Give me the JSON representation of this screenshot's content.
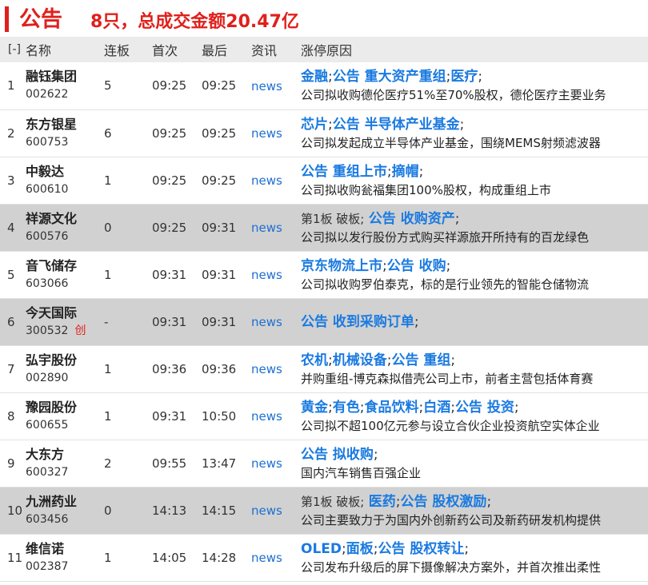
{
  "header": {
    "title": "公告",
    "summary": "8只，总成交金额20.47亿"
  },
  "columns": {
    "toggle": "[-]",
    "name": "名称",
    "boards": "连板",
    "first": "首次",
    "last": "最后",
    "news": "资讯",
    "reason": "涨停原因"
  },
  "rows": [
    {
      "idx": "1",
      "name": "融钰集团",
      "code": "002622",
      "badge": "",
      "boards": "5",
      "first": "09:25",
      "last": "09:25",
      "news": "news",
      "prefix": "",
      "tags": [
        "金融",
        "公告 重大资产重组",
        "医疗"
      ],
      "desc": "公司拟收购德伦医疗51%至70%股权，德伦医疗主要业务"
    },
    {
      "idx": "2",
      "name": "东方银星",
      "code": "600753",
      "badge": "",
      "boards": "6",
      "first": "09:25",
      "last": "09:25",
      "news": "news",
      "prefix": "",
      "tags": [
        "芯片",
        "公告 半导体产业基金"
      ],
      "desc": "公司拟发起成立半导体产业基金，围绕MEMS射频滤波器"
    },
    {
      "idx": "3",
      "name": "中毅达",
      "code": "600610",
      "badge": "",
      "boards": "1",
      "first": "09:25",
      "last": "09:25",
      "news": "news",
      "prefix": "",
      "tags": [
        "公告 重组上市",
        "摘帽"
      ],
      "desc": "公司拟收购瓮福集团100%股权，构成重组上市"
    },
    {
      "idx": "4",
      "name": "祥源文化",
      "code": "600576",
      "badge": "",
      "boards": "0",
      "first": "09:25",
      "last": "09:31",
      "news": "news",
      "prefix": "第1板 破板;",
      "tags": [
        "公告 收购资产"
      ],
      "desc": "公司拟以发行股份方式购买祥源旅开所持有的百龙绿色"
    },
    {
      "idx": "5",
      "name": "音飞储存",
      "code": "603066",
      "badge": "",
      "boards": "1",
      "first": "09:31",
      "last": "09:31",
      "news": "news",
      "prefix": "",
      "tags": [
        "京东物流上市",
        "公告 收购"
      ],
      "desc": "公司拟收购罗伯泰克，标的是行业领先的智能仓储物流"
    },
    {
      "idx": "6",
      "name": "今天国际",
      "code": "300532",
      "badge": "创",
      "boards": "-",
      "first": "09:31",
      "last": "09:31",
      "news": "news",
      "prefix": "",
      "tags": [
        "公告 收到采购订单"
      ],
      "desc": ""
    },
    {
      "idx": "7",
      "name": "弘宇股份",
      "code": "002890",
      "badge": "",
      "boards": "1",
      "first": "09:36",
      "last": "09:36",
      "news": "news",
      "prefix": "",
      "tags": [
        "农机",
        "机械设备",
        "公告 重组"
      ],
      "desc": "并购重组-博克森拟借壳公司上市，前者主营包括体育赛"
    },
    {
      "idx": "8",
      "name": "豫园股份",
      "code": "600655",
      "badge": "",
      "boards": "1",
      "first": "09:31",
      "last": "10:50",
      "news": "news",
      "prefix": "",
      "tags": [
        "黄金",
        "有色",
        "食品饮料",
        "白酒",
        "公告 投资"
      ],
      "desc": "公司拟不超100亿元参与设立合伙企业投资航空实体企业"
    },
    {
      "idx": "9",
      "name": "大东方",
      "code": "600327",
      "badge": "",
      "boards": "2",
      "first": "09:55",
      "last": "13:47",
      "news": "news",
      "prefix": "",
      "tags": [
        "公告 拟收购"
      ],
      "desc": "国内汽车销售百强企业"
    },
    {
      "idx": "10",
      "name": "九洲药业",
      "code": "603456",
      "badge": "",
      "boards": "0",
      "first": "14:13",
      "last": "14:15",
      "news": "news",
      "prefix": "第1板 破板;",
      "tags": [
        "医药",
        "公告 股权激励"
      ],
      "desc": "公司主要致力于为国内外创新药公司及新药研发机构提供"
    },
    {
      "idx": "11",
      "name": "维信诺",
      "code": "002387",
      "badge": "",
      "boards": "1",
      "first": "14:05",
      "last": "14:28",
      "news": "news",
      "prefix": "",
      "tags": [
        "OLED",
        "面板",
        "公告 股权转让"
      ],
      "desc": "公司发布升级后的屏下摄像解决方案外，并首次推出柔性"
    }
  ],
  "highlight_rows": [
    4,
    6,
    10
  ],
  "colors": {
    "title_red": "#e0201c",
    "tag_blue": "#1a7ae0",
    "news_blue": "#1d6fd1",
    "header_bg": "#ebebeb",
    "highlight_row_bg": "#d1d1d1"
  }
}
